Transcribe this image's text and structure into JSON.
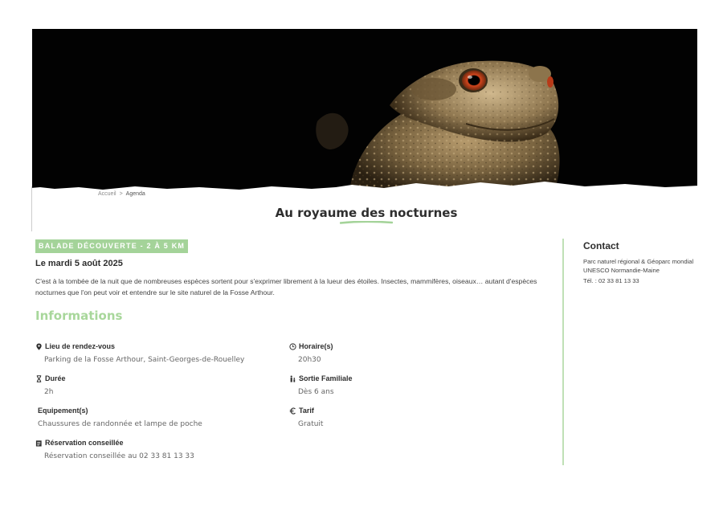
{
  "breadcrumb": {
    "home": "Accueil",
    "separator": ">",
    "current": "Agenda"
  },
  "page_title": "Au royaume des nocturnes",
  "event": {
    "tag": "BALADE DÉCOUVERTE - 2 À 5 KM",
    "date": "Le mardi 5 août 2025",
    "description": "C'est à la tombée de la nuit que de nombreuses espèces sortent pour s'exprimer librement à la lueur des étoiles. Insectes, mammifères, oiseaux… autant d'espèces nocturnes que l'on peut voir et entendre sur le site naturel de la Fosse Arthour."
  },
  "informations": {
    "heading": "Informations",
    "meeting_place": {
      "label": "Lieu de rendez-vous",
      "value": "Parking de la Fosse Arthour, Saint-Georges-de-Rouelley"
    },
    "schedule": {
      "label": "Horaire(s)",
      "value": "20h30"
    },
    "duration": {
      "label": "Durée",
      "value": "2h"
    },
    "family": {
      "label": "Sortie Familiale",
      "value": "Dès 6 ans"
    },
    "equipment": {
      "label": "Equipement(s)",
      "value": "Chaussures de randonnée et lampe de poche"
    },
    "price": {
      "label": "Tarif",
      "value": "Gratuit"
    },
    "reservation": {
      "label": "Réservation conseillée",
      "value": "Réservation conseillée au 02 33 81 13 33"
    }
  },
  "contact": {
    "heading": "Contact",
    "organization": "Parc naturel régional & Géoparc mondial UNESCO Normandie-Maine",
    "phone": "Tél. : 02 33 81 13 33"
  },
  "icons": {
    "location": "map-pin-icon",
    "schedule": "clock-icon",
    "duration": "hourglass-icon",
    "family": "family-icon",
    "price": "euro-icon",
    "reservation": "clipboard-icon"
  },
  "colors": {
    "accent_green": "#a4d399",
    "heading_green": "#a8d79b",
    "rule_green": "#bfe0b6"
  }
}
